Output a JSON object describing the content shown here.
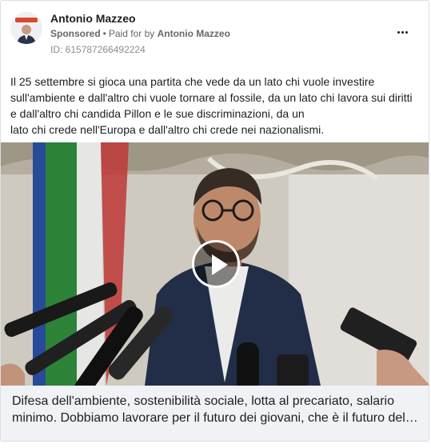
{
  "post": {
    "page_name": "Antonio Mazzeo",
    "sponsored_label": "Sponsored",
    "separator": "•",
    "paid_for_prefix": "Paid for by",
    "paid_for_name": "Antonio Mazzeo",
    "ad_id": "ID: 615787266492224",
    "text_lines": [
      "Il 25 settembre si gioca una partita che vede da un lato chi vuole investire",
      "sull'ambiente e dall'altro chi vuole tornare al fossile, da un lato chi lavora sui diritti",
      "e dall'altro chi candida Pillon e le sue discriminazioni, da un",
      "lato chi crede nell'Europa e dall'altro chi crede nei nazionalismi."
    ],
    "video_caption_lines": [
      "Difesa dell'ambiente, sostenibilità sociale, lotta al precariato, salario",
      "minimo. Dobbiamo lavorare per il futuro dei giovani, che è il futuro del…"
    ]
  },
  "icons": {
    "more": "more-horizontal-icon",
    "play": "play-icon"
  },
  "colors": {
    "text_primary": "#1c1e21",
    "text_secondary": "#65676b",
    "caption_bg": "#f0f2f5",
    "avatar_bar": "#d9482b"
  }
}
